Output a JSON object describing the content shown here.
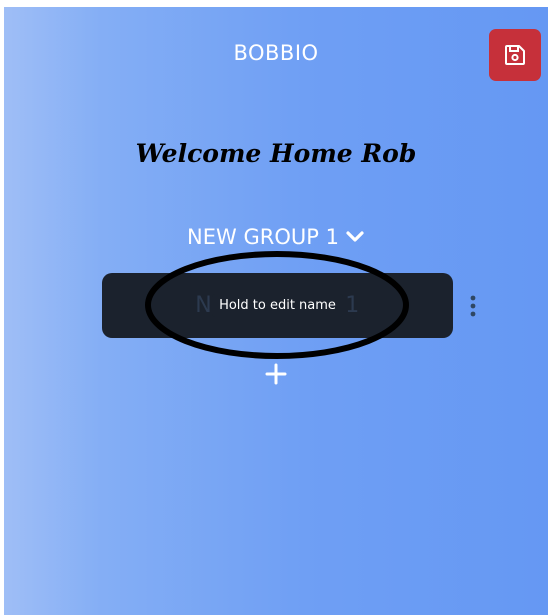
{
  "header": {
    "title": "BOBBIO",
    "save_icon": "floppy-disk-icon"
  },
  "welcome": {
    "text": "Welcome Home Rob"
  },
  "group_selector": {
    "label": "NEW GROUP 1",
    "icon": "chevron-down-icon"
  },
  "group_card": {
    "name": "NEW GROUP 1",
    "tooltip": "Hold to edit name",
    "menu_icon": "kebab-menu-icon"
  },
  "add_button": {
    "icon": "plus-icon"
  },
  "colors": {
    "save_button": "#c6303a",
    "card": "#1b222d",
    "background_start": "#9fbef6",
    "background_end": "#6598f3"
  }
}
